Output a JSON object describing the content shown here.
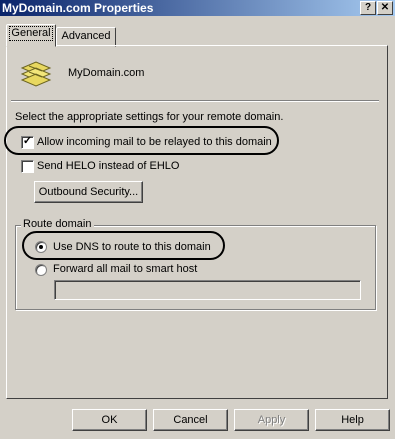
{
  "window": {
    "title": "MyDomain.com Properties",
    "help_glyph": "?",
    "close_glyph": "✕"
  },
  "tabs": [
    {
      "label": "General",
      "active": true
    },
    {
      "label": "Advanced",
      "active": false
    }
  ],
  "general": {
    "domain_icon": "domain-icon",
    "domain_name": "MyDomain.com",
    "instruction": "Select the appropriate settings for your remote domain.",
    "allow_relay": {
      "label": "Allow incoming mail to be relayed to this domain",
      "checked": true
    },
    "send_helo": {
      "label": "Send HELO instead of EHLO",
      "checked": false
    },
    "outbound_security_label": "Outbound Security...",
    "route_domain": {
      "legend": "Route domain",
      "use_dns": {
        "label": "Use DNS to route to this domain",
        "selected": true
      },
      "forward_smart_host": {
        "label": "Forward all mail to smart host",
        "selected": false
      },
      "smart_host_value": ""
    }
  },
  "footer": {
    "ok": "OK",
    "cancel": "Cancel",
    "apply": "Apply",
    "help": "Help"
  },
  "colors": {
    "face": "#d4d0c8",
    "titlebar_start": "#0a246a",
    "titlebar_end": "#a6caf0"
  }
}
